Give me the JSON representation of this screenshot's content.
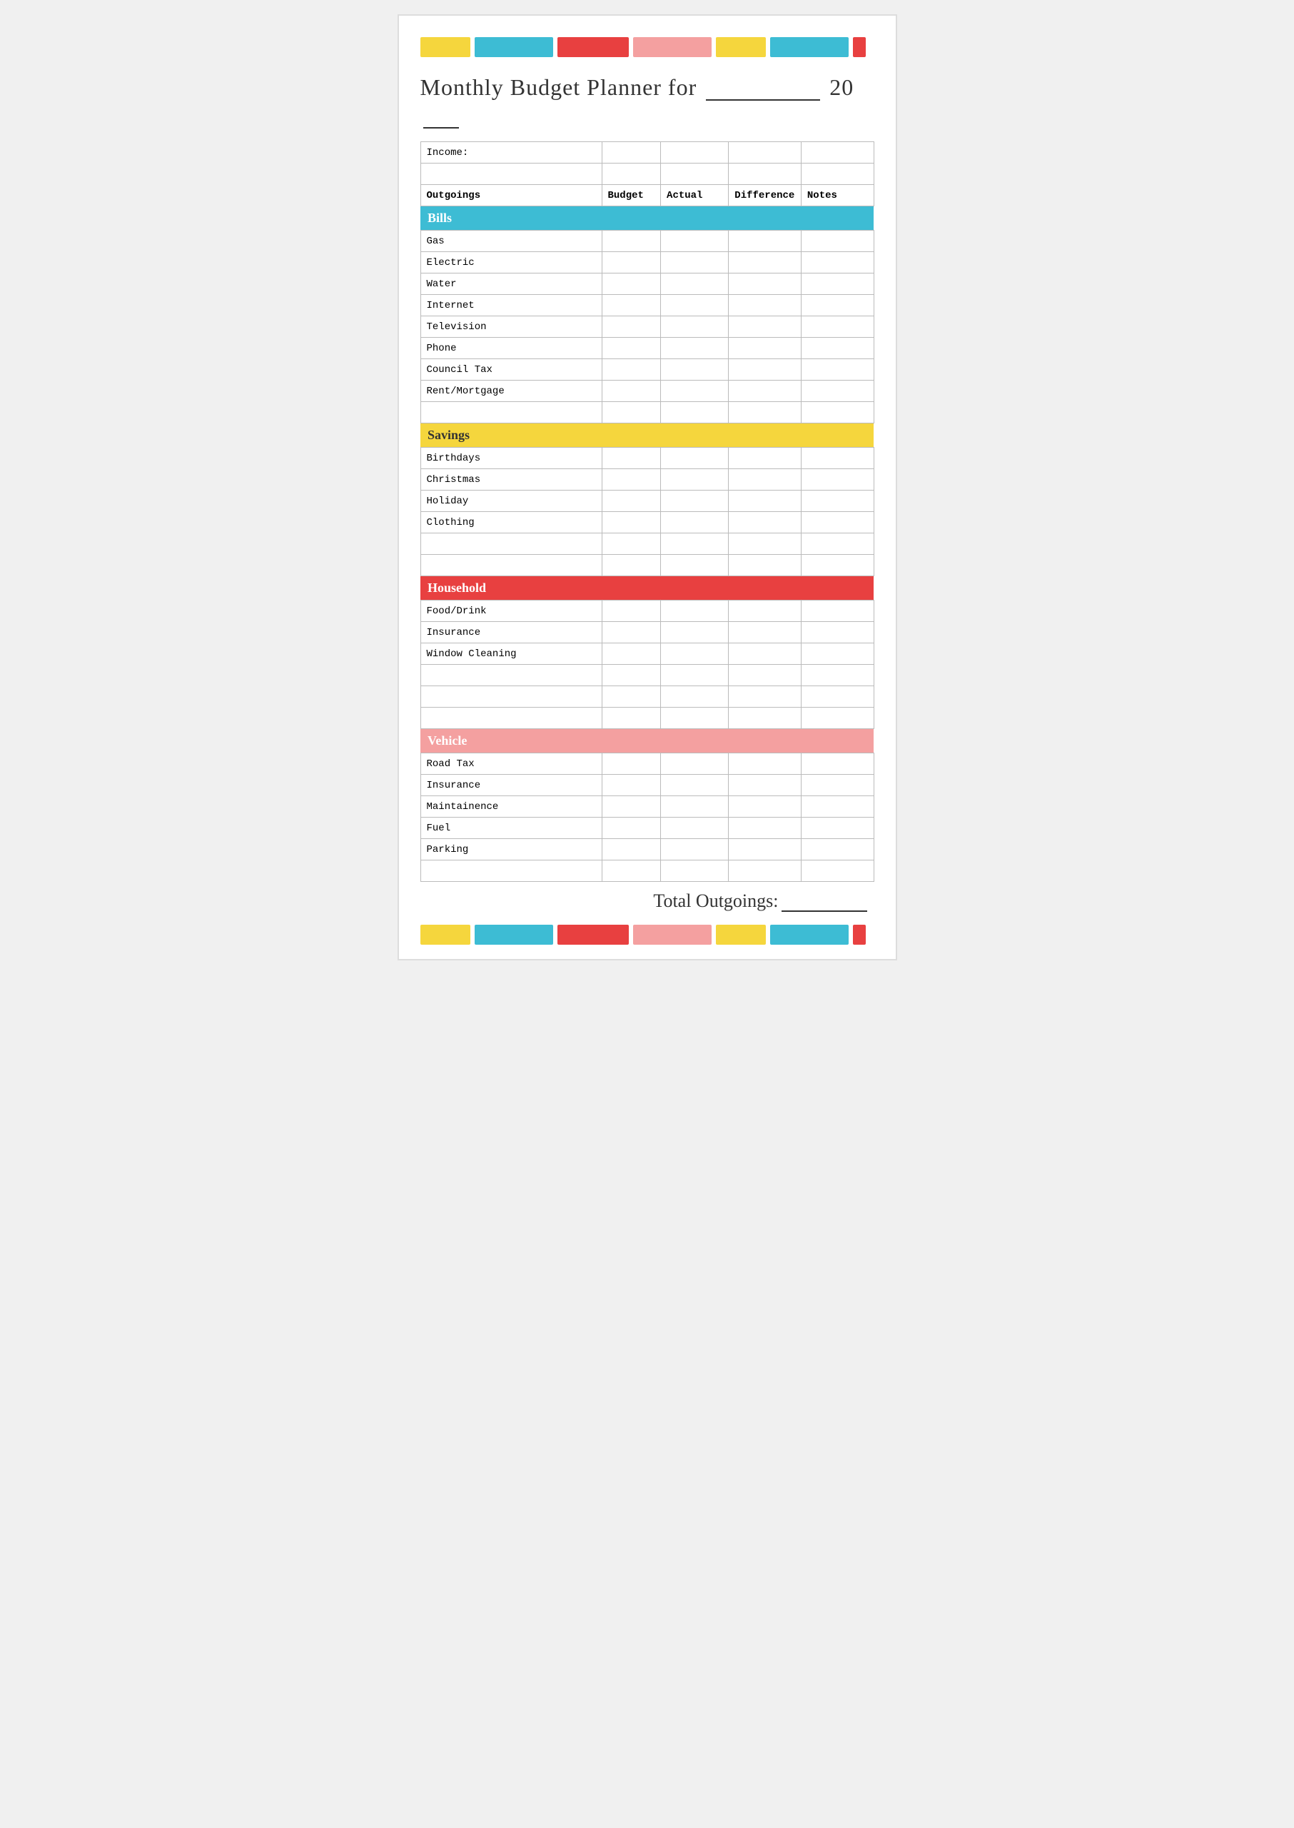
{
  "title": {
    "text": "Monthly Budget Planner for",
    "year_prefix": "20"
  },
  "color_bars_top": [
    {
      "color": "yellow",
      "class": "bar-yellow"
    },
    {
      "color": "teal",
      "class": "bar-teal"
    },
    {
      "color": "red",
      "class": "bar-red"
    },
    {
      "color": "pink",
      "class": "bar-pink"
    },
    {
      "color": "yellow",
      "class": "bar-yellow2"
    },
    {
      "color": "teal",
      "class": "bar-teal2"
    },
    {
      "color": "red",
      "class": "bar-red2"
    }
  ],
  "table": {
    "income_label": "Income:",
    "headers": {
      "outgoings": "Outgoings",
      "budget": "Budget",
      "actual": "Actual",
      "difference": "Difference",
      "notes": "Notes"
    },
    "sections": [
      {
        "id": "bills",
        "label": "Bills",
        "style": "section-bills",
        "rows": [
          "Gas",
          "Electric",
          "Water",
          "Internet",
          "Television",
          "Phone",
          "Council Tax",
          "Rent/Mortgage",
          ""
        ]
      },
      {
        "id": "savings",
        "label": "Savings",
        "style": "section-savings",
        "rows": [
          "Birthdays",
          "Christmas",
          "Holiday",
          "Clothing",
          "",
          ""
        ]
      },
      {
        "id": "household",
        "label": "Household",
        "style": "section-household",
        "rows": [
          "Food/Drink",
          "Insurance",
          "Window Cleaning",
          "",
          "",
          ""
        ]
      },
      {
        "id": "vehicle",
        "label": "Vehicle",
        "style": "section-vehicle",
        "rows": [
          "Road Tax",
          "Insurance",
          "Maintainence",
          "Fuel",
          "Parking",
          ""
        ]
      }
    ]
  },
  "total": {
    "label": "Total Outgoings:"
  }
}
